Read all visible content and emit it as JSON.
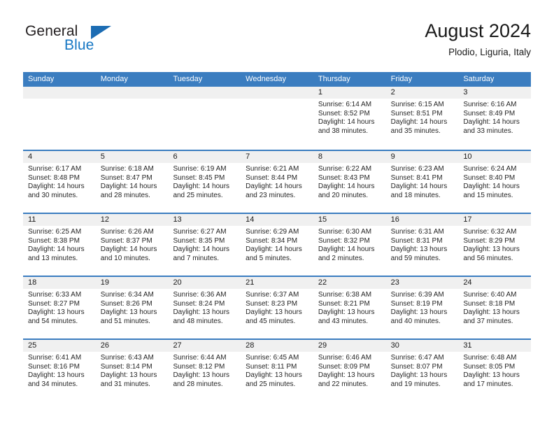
{
  "brand": {
    "name_top": "General",
    "name_bottom": "Blue",
    "triangle_color": "#1c6cb3",
    "blue_color": "#1878c4"
  },
  "header": {
    "title": "August 2024",
    "subtitle": "Plodio, Liguria, Italy"
  },
  "theme": {
    "header_bg": "#3b7dc0",
    "day_number_bg": "#f0f0f0",
    "row_divider": "#3b7dc0"
  },
  "weekdays": [
    "Sunday",
    "Monday",
    "Tuesday",
    "Wednesday",
    "Thursday",
    "Friday",
    "Saturday"
  ],
  "weeks": [
    [
      {
        "day": "",
        "sunrise": "",
        "sunset": "",
        "daylight": "",
        "empty": true
      },
      {
        "day": "",
        "sunrise": "",
        "sunset": "",
        "daylight": "",
        "empty": true
      },
      {
        "day": "",
        "sunrise": "",
        "sunset": "",
        "daylight": "",
        "empty": true
      },
      {
        "day": "",
        "sunrise": "",
        "sunset": "",
        "daylight": "",
        "empty": true
      },
      {
        "day": "1",
        "sunrise": "Sunrise: 6:14 AM",
        "sunset": "Sunset: 8:52 PM",
        "daylight": "Daylight: 14 hours and 38 minutes."
      },
      {
        "day": "2",
        "sunrise": "Sunrise: 6:15 AM",
        "sunset": "Sunset: 8:51 PM",
        "daylight": "Daylight: 14 hours and 35 minutes."
      },
      {
        "day": "3",
        "sunrise": "Sunrise: 6:16 AM",
        "sunset": "Sunset: 8:49 PM",
        "daylight": "Daylight: 14 hours and 33 minutes."
      }
    ],
    [
      {
        "day": "4",
        "sunrise": "Sunrise: 6:17 AM",
        "sunset": "Sunset: 8:48 PM",
        "daylight": "Daylight: 14 hours and 30 minutes."
      },
      {
        "day": "5",
        "sunrise": "Sunrise: 6:18 AM",
        "sunset": "Sunset: 8:47 PM",
        "daylight": "Daylight: 14 hours and 28 minutes."
      },
      {
        "day": "6",
        "sunrise": "Sunrise: 6:19 AM",
        "sunset": "Sunset: 8:45 PM",
        "daylight": "Daylight: 14 hours and 25 minutes."
      },
      {
        "day": "7",
        "sunrise": "Sunrise: 6:21 AM",
        "sunset": "Sunset: 8:44 PM",
        "daylight": "Daylight: 14 hours and 23 minutes."
      },
      {
        "day": "8",
        "sunrise": "Sunrise: 6:22 AM",
        "sunset": "Sunset: 8:43 PM",
        "daylight": "Daylight: 14 hours and 20 minutes."
      },
      {
        "day": "9",
        "sunrise": "Sunrise: 6:23 AM",
        "sunset": "Sunset: 8:41 PM",
        "daylight": "Daylight: 14 hours and 18 minutes."
      },
      {
        "day": "10",
        "sunrise": "Sunrise: 6:24 AM",
        "sunset": "Sunset: 8:40 PM",
        "daylight": "Daylight: 14 hours and 15 minutes."
      }
    ],
    [
      {
        "day": "11",
        "sunrise": "Sunrise: 6:25 AM",
        "sunset": "Sunset: 8:38 PM",
        "daylight": "Daylight: 14 hours and 13 minutes."
      },
      {
        "day": "12",
        "sunrise": "Sunrise: 6:26 AM",
        "sunset": "Sunset: 8:37 PM",
        "daylight": "Daylight: 14 hours and 10 minutes."
      },
      {
        "day": "13",
        "sunrise": "Sunrise: 6:27 AM",
        "sunset": "Sunset: 8:35 PM",
        "daylight": "Daylight: 14 hours and 7 minutes."
      },
      {
        "day": "14",
        "sunrise": "Sunrise: 6:29 AM",
        "sunset": "Sunset: 8:34 PM",
        "daylight": "Daylight: 14 hours and 5 minutes."
      },
      {
        "day": "15",
        "sunrise": "Sunrise: 6:30 AM",
        "sunset": "Sunset: 8:32 PM",
        "daylight": "Daylight: 14 hours and 2 minutes."
      },
      {
        "day": "16",
        "sunrise": "Sunrise: 6:31 AM",
        "sunset": "Sunset: 8:31 PM",
        "daylight": "Daylight: 13 hours and 59 minutes."
      },
      {
        "day": "17",
        "sunrise": "Sunrise: 6:32 AM",
        "sunset": "Sunset: 8:29 PM",
        "daylight": "Daylight: 13 hours and 56 minutes."
      }
    ],
    [
      {
        "day": "18",
        "sunrise": "Sunrise: 6:33 AM",
        "sunset": "Sunset: 8:27 PM",
        "daylight": "Daylight: 13 hours and 54 minutes."
      },
      {
        "day": "19",
        "sunrise": "Sunrise: 6:34 AM",
        "sunset": "Sunset: 8:26 PM",
        "daylight": "Daylight: 13 hours and 51 minutes."
      },
      {
        "day": "20",
        "sunrise": "Sunrise: 6:36 AM",
        "sunset": "Sunset: 8:24 PM",
        "daylight": "Daylight: 13 hours and 48 minutes."
      },
      {
        "day": "21",
        "sunrise": "Sunrise: 6:37 AM",
        "sunset": "Sunset: 8:23 PM",
        "daylight": "Daylight: 13 hours and 45 minutes."
      },
      {
        "day": "22",
        "sunrise": "Sunrise: 6:38 AM",
        "sunset": "Sunset: 8:21 PM",
        "daylight": "Daylight: 13 hours and 43 minutes."
      },
      {
        "day": "23",
        "sunrise": "Sunrise: 6:39 AM",
        "sunset": "Sunset: 8:19 PM",
        "daylight": "Daylight: 13 hours and 40 minutes."
      },
      {
        "day": "24",
        "sunrise": "Sunrise: 6:40 AM",
        "sunset": "Sunset: 8:18 PM",
        "daylight": "Daylight: 13 hours and 37 minutes."
      }
    ],
    [
      {
        "day": "25",
        "sunrise": "Sunrise: 6:41 AM",
        "sunset": "Sunset: 8:16 PM",
        "daylight": "Daylight: 13 hours and 34 minutes."
      },
      {
        "day": "26",
        "sunrise": "Sunrise: 6:43 AM",
        "sunset": "Sunset: 8:14 PM",
        "daylight": "Daylight: 13 hours and 31 minutes."
      },
      {
        "day": "27",
        "sunrise": "Sunrise: 6:44 AM",
        "sunset": "Sunset: 8:12 PM",
        "daylight": "Daylight: 13 hours and 28 minutes."
      },
      {
        "day": "28",
        "sunrise": "Sunrise: 6:45 AM",
        "sunset": "Sunset: 8:11 PM",
        "daylight": "Daylight: 13 hours and 25 minutes."
      },
      {
        "day": "29",
        "sunrise": "Sunrise: 6:46 AM",
        "sunset": "Sunset: 8:09 PM",
        "daylight": "Daylight: 13 hours and 22 minutes."
      },
      {
        "day": "30",
        "sunrise": "Sunrise: 6:47 AM",
        "sunset": "Sunset: 8:07 PM",
        "daylight": "Daylight: 13 hours and 19 minutes."
      },
      {
        "day": "31",
        "sunrise": "Sunrise: 6:48 AM",
        "sunset": "Sunset: 8:05 PM",
        "daylight": "Daylight: 13 hours and 17 minutes."
      }
    ]
  ]
}
